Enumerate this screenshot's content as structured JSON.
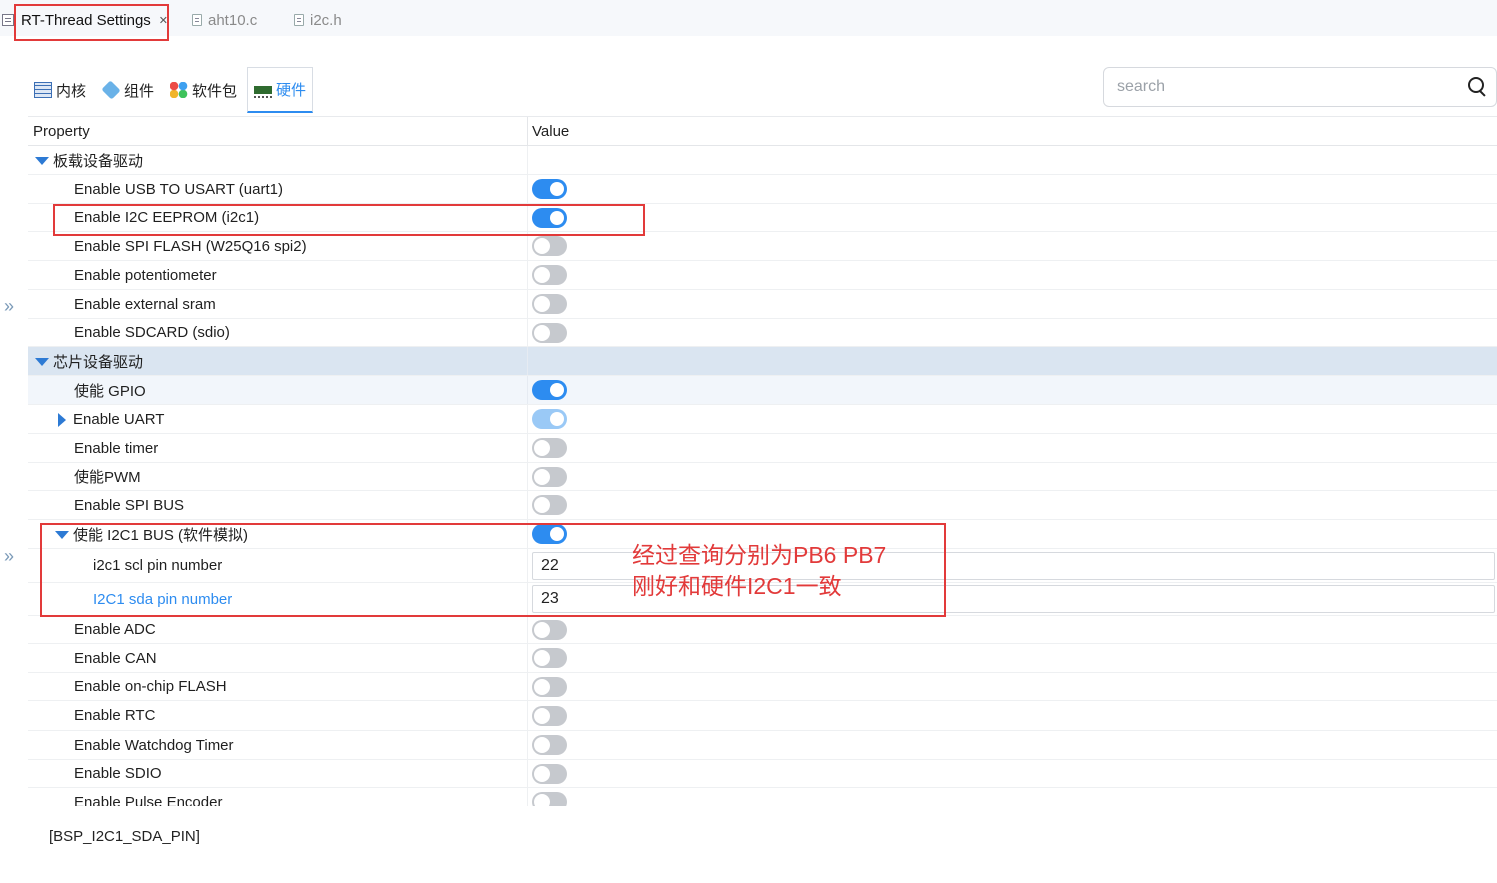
{
  "editor_tabs": [
    {
      "label": "RT-Thread Settings",
      "active": true,
      "closable": true,
      "icon": "settings-icon"
    },
    {
      "label": "aht10.c",
      "active": false,
      "icon": "c-file-icon"
    },
    {
      "label": "i2c.h",
      "active": false,
      "icon": "h-file-icon"
    }
  ],
  "category_tabs": [
    {
      "label": "内核",
      "icon": "kernel-icon"
    },
    {
      "label": "组件",
      "icon": "component-icon"
    },
    {
      "label": "软件包",
      "icon": "package-icon"
    },
    {
      "label": "硬件",
      "icon": "hardware-icon",
      "active": true
    }
  ],
  "search": {
    "placeholder": "search"
  },
  "table": {
    "header": {
      "property": "Property",
      "value": "Value"
    },
    "groups": [
      {
        "label": "板载设备驱动",
        "expanded": true,
        "items": [
          {
            "label": "Enable USB TO USART (uart1)",
            "enabled": true
          },
          {
            "label": "Enable I2C EEPROM (i2c1)",
            "enabled": true
          },
          {
            "label": "Enable SPI FLASH (W25Q16 spi2)",
            "enabled": false
          },
          {
            "label": "Enable potentiometer",
            "enabled": false
          },
          {
            "label": "Enable external sram",
            "enabled": false
          },
          {
            "label": "Enable SDCARD (sdio)",
            "enabled": false
          }
        ]
      },
      {
        "label": "芯片设备驱动",
        "expanded": true,
        "items": [
          {
            "label": "使能 GPIO",
            "enabled": true
          },
          {
            "label": "Enable UART",
            "enabled": true,
            "collapsed": true
          },
          {
            "label": "Enable timer",
            "enabled": false
          },
          {
            "label": "使能PWM",
            "enabled": false
          },
          {
            "label": "Enable SPI BUS",
            "enabled": false
          },
          {
            "label": "使能 I2C1 BUS (软件模拟)",
            "enabled": true,
            "expanded": true,
            "children": [
              {
                "label": "i2c1 scl pin number",
                "value": "22"
              },
              {
                "label": "I2C1 sda pin number",
                "value": "23"
              }
            ]
          },
          {
            "label": "Enable ADC",
            "enabled": false
          },
          {
            "label": "Enable CAN",
            "enabled": false
          },
          {
            "label": "Enable on-chip FLASH",
            "enabled": false
          },
          {
            "label": "Enable RTC",
            "enabled": false
          },
          {
            "label": "Enable Watchdog Timer",
            "enabled": false
          },
          {
            "label": "Enable SDIO",
            "enabled": false
          },
          {
            "label": "Enable Pulse Encoder",
            "enabled": false
          }
        ]
      }
    ]
  },
  "annotation": {
    "line1": "经过查询分别为PB6 PB7",
    "line2": "刚好和硬件I2C1一致"
  },
  "footer": {
    "macro": "[BSP_I2C1_SDA_PIN]"
  },
  "colors": {
    "accent": "#2d8cf0",
    "annotation_red": "#e23a3a",
    "toggle_off": "#c6c9ce",
    "selected_row": "#dae5f1"
  }
}
